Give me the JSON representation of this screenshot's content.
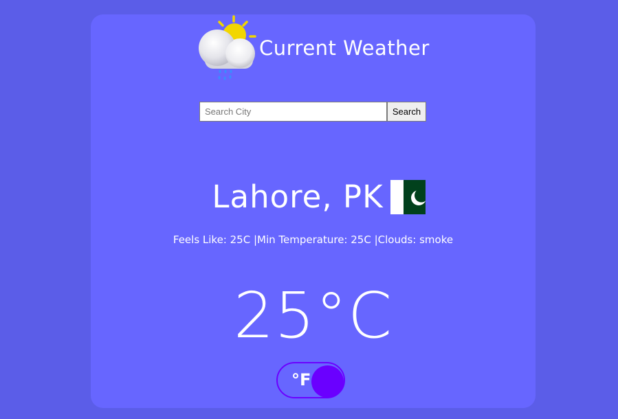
{
  "header": {
    "title": "Current Weather",
    "icon": "partly-cloudy-rain-icon"
  },
  "search": {
    "placeholder": "Search City",
    "value": "",
    "button_label": "Search"
  },
  "location": {
    "city": "Lahore, PK",
    "flag": "pakistan-flag"
  },
  "details": {
    "text": "Feels Like: 25C |Min Temperature: 25C |Clouds: smoke"
  },
  "current": {
    "temperature": "25°C"
  },
  "unit_toggle": {
    "label": "°F"
  },
  "colors": {
    "page_background": "#5b5de8",
    "card_background": "#6766ff",
    "toggle_accent": "#6a00ff",
    "flag_green": "#01411c"
  }
}
